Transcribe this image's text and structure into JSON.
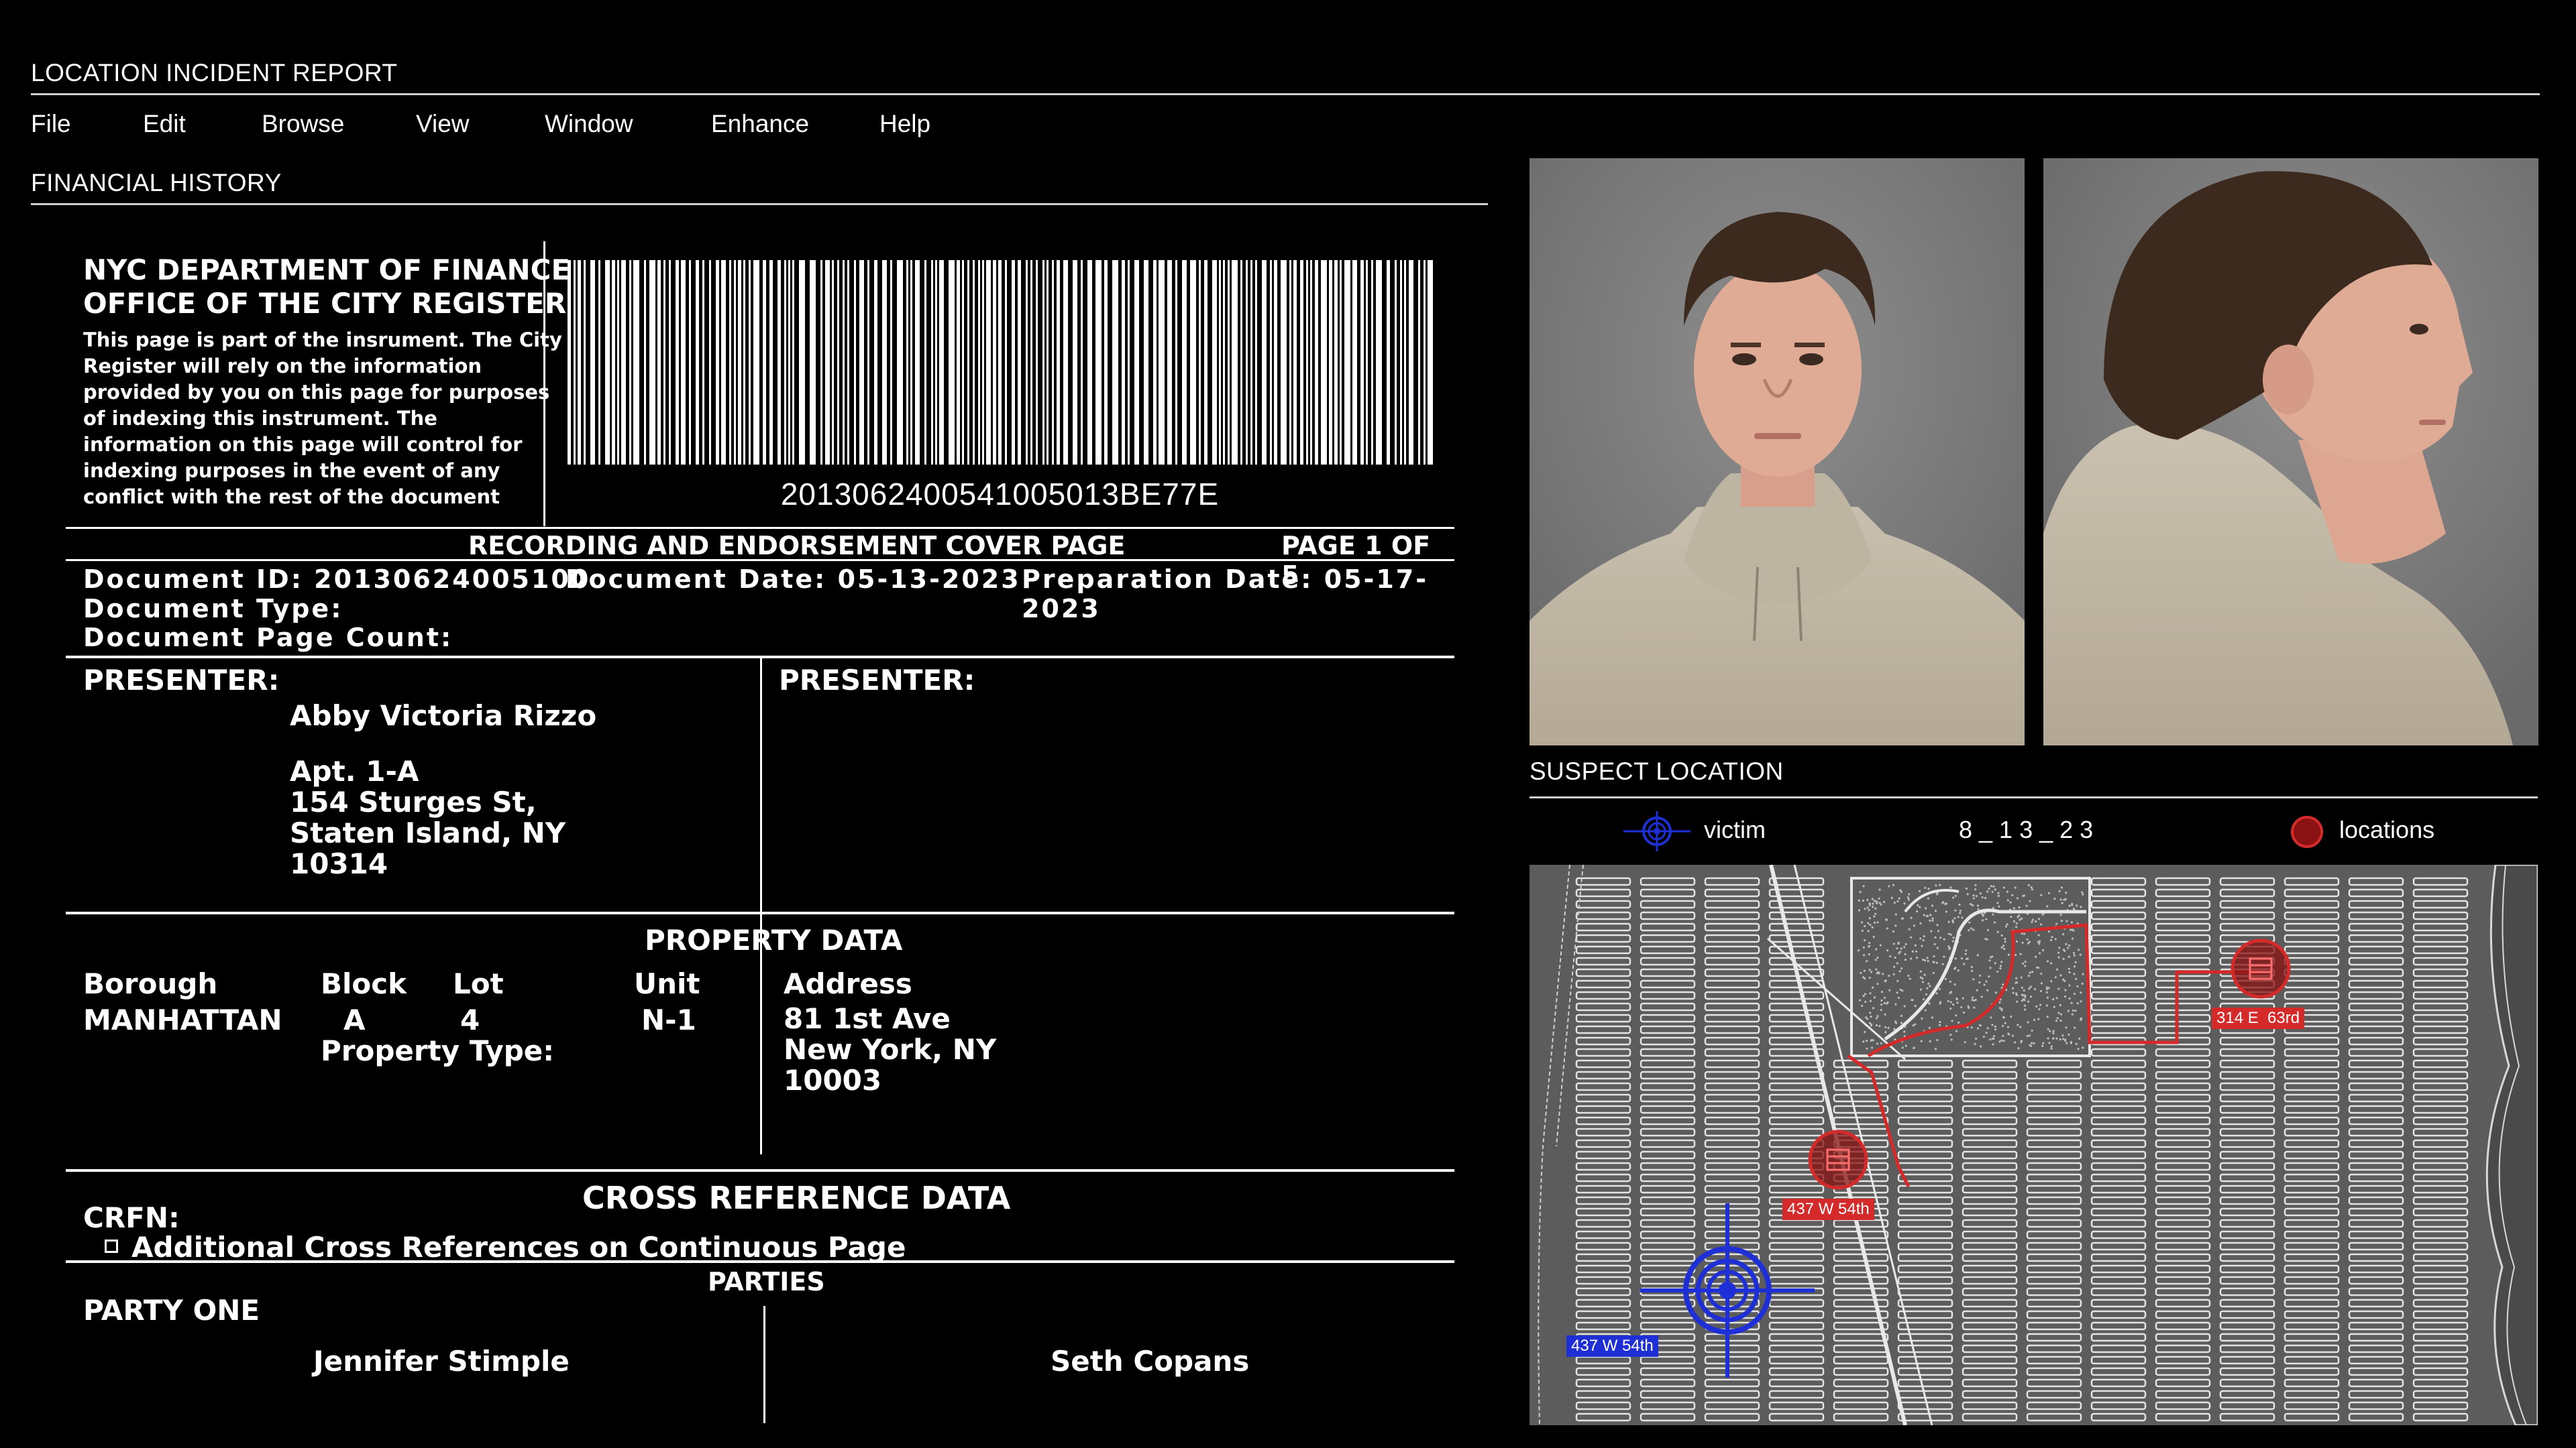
{
  "window": {
    "title": "LOCATION INCIDENT REPORT"
  },
  "menu": [
    "File",
    "Edit",
    "Browse",
    "View",
    "Window",
    "Enhance",
    "Help"
  ],
  "section_financial": "FINANCIAL HISTORY",
  "document": {
    "agency_line1": "NYC DEPARTMENT OF FINANCE",
    "agency_line2": "OFFICE OF THE CITY REGISTER",
    "notice": [
      "This page is part of the insrument. The City",
      "Register will rely on the information",
      "provided by you on this page for purposes",
      "of indexing this instrument. The",
      "information on this page will control for",
      "indexing purposes in the event of any",
      "conflict with the rest of the document"
    ],
    "barcode_text": "2013062400541005013BE77E",
    "cover_title": "RECORDING AND ENDORSEMENT COVER PAGE",
    "page_label": "PAGE 1 OF 5",
    "document_id": "Document ID: 20130624005100",
    "document_date": "Document Date: 05-13-2023",
    "preparation_date": "Preparation Date: 05-17-2023",
    "document_type": "Document Type:",
    "page_count": "Document Page Count:",
    "presenter_label": "PRESENTER:",
    "presenter_label_2": "PRESENTER:",
    "presenter_name": "Abby Victoria Rizzo",
    "presenter_address": [
      "Apt. 1-A",
      "154 Sturges St,",
      "Staten Island, NY",
      "10314"
    ],
    "property_title": "PROPERTY DATA",
    "property_headers": {
      "borough": "Borough",
      "block": "Block",
      "lot": "Lot",
      "unit": "Unit",
      "address": "Address"
    },
    "property_values": {
      "borough": "MANHATTAN",
      "block": "A",
      "lot": "4",
      "unit": "N-1",
      "address": [
        "81 1st Ave",
        "New York, NY",
        "10003"
      ]
    },
    "property_type": "Property Type:",
    "cross_ref_title": "CROSS REFERENCE DATA",
    "crfn": "CRFN:",
    "additional_refs": "Additional Cross References on Continuous Page",
    "parties_title": "PARTIES",
    "party_one": "PARTY ONE",
    "party_one_name": "Jennifer Stimple",
    "party_two_name": "Seth Copans"
  },
  "suspect_location": {
    "title": "SUSPECT LOCATION",
    "legend_victim": "victim",
    "legend_code": "8 _ 1 3 _ 2 3",
    "legend_locations": "locations",
    "marker_labels": [
      "314 E  63rd",
      "437 W 54th",
      "437 W 54th"
    ],
    "colors": {
      "location_red": "#d42a2a",
      "victim_blue": "#1e2fd6",
      "map_bg": "#5c5c5c"
    }
  },
  "icons": [
    "barcode",
    "target-crosshair-icon",
    "location-circle-icon",
    "checkbox-icon"
  ]
}
